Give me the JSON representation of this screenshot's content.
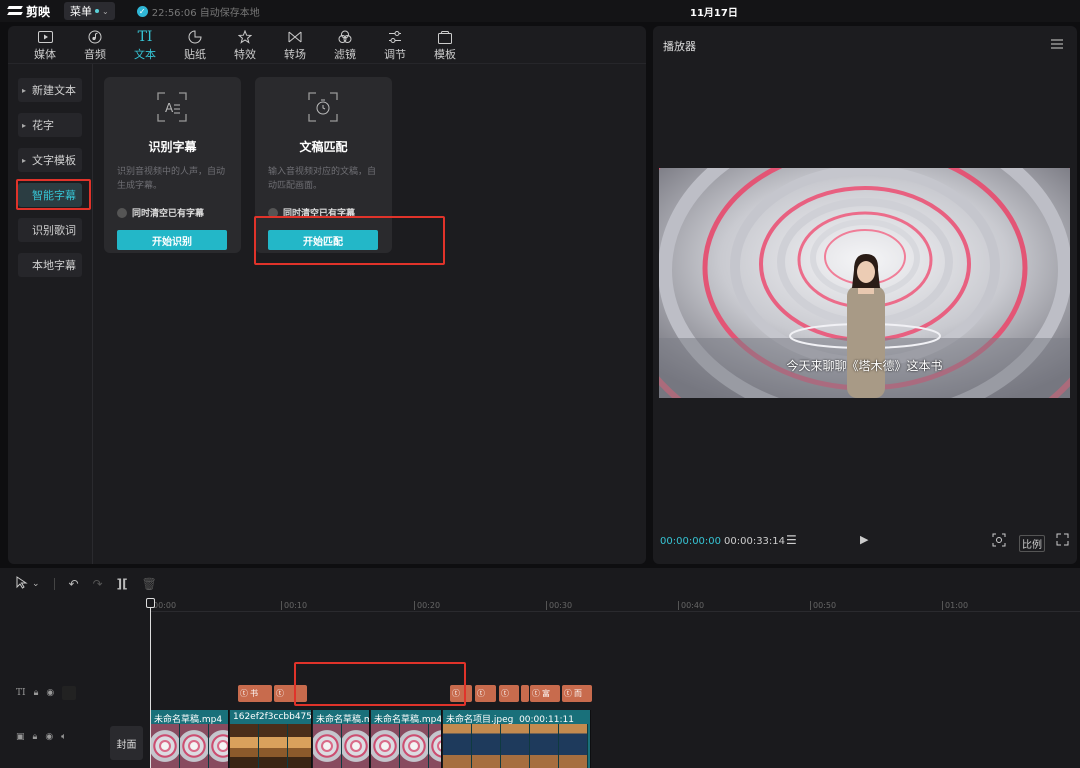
{
  "topbar": {
    "app_name": "剪映",
    "menu_label": "菜单",
    "save_status": "22:56:06 自动保存本地",
    "date": "11月17日"
  },
  "toolbar": {
    "tabs": [
      {
        "label": "媒体",
        "icon": "media-icon"
      },
      {
        "label": "音频",
        "icon": "audio-icon"
      },
      {
        "label": "文本",
        "icon": "text-icon",
        "glyph": "TI"
      },
      {
        "label": "贴纸",
        "icon": "sticker-icon"
      },
      {
        "label": "特效",
        "icon": "effects-icon"
      },
      {
        "label": "转场",
        "icon": "transition-icon"
      },
      {
        "label": "滤镜",
        "icon": "filter-icon"
      },
      {
        "label": "调节",
        "icon": "adjust-icon"
      },
      {
        "label": "模板",
        "icon": "template-icon"
      }
    ],
    "active": "文本"
  },
  "sidebar": {
    "items": [
      {
        "label": "新建文本"
      },
      {
        "label": "花字"
      },
      {
        "label": "文字模板"
      },
      {
        "label": "智能字幕"
      },
      {
        "label": "识别歌词"
      },
      {
        "label": "本地字幕"
      }
    ],
    "active": "智能字幕"
  },
  "cards": [
    {
      "title": "识别字幕",
      "desc": "识别音视频中的人声，自动生成字幕。",
      "checkbox": "同时清空已有字幕",
      "button": "开始识别"
    },
    {
      "title": "文稿匹配",
      "desc": "输入音视频对应的文稿，自动匹配画面。",
      "checkbox": "同时清空已有字幕",
      "button": "开始匹配"
    }
  ],
  "player": {
    "title": "播放器",
    "subtitle": "今天来聊聊《塔木德》这本书",
    "current_time": "00:00:00:00",
    "total_time": "00:00:33:14",
    "ratio_label": "比例"
  },
  "timeline": {
    "ruler": [
      "00:00",
      "00:10",
      "00:20",
      "00:30",
      "00:40",
      "00:50",
      "01:00"
    ],
    "text_clips": [
      "书",
      "",
      "",
      "",
      "",
      "",
      "富",
      "而"
    ],
    "cover_label": "封面",
    "video_clips": [
      {
        "label": "未命名草稿.mp4",
        "thumb": "tunnel"
      },
      {
        "label": "162ef2f3ccbb475c",
        "thumb": "room"
      },
      {
        "label": "未命名草稿.m",
        "thumb": "tunnel"
      },
      {
        "label": "未命名草稿.mp4",
        "thumb": "tunnel"
      },
      {
        "label": "未命名项目.jpeg",
        "thumb": "aquarium",
        "duration": "00:00:11:11"
      }
    ]
  },
  "colors": {
    "accent": "#36c3d3",
    "highlight_box": "#e0332a",
    "text_clip": "#c86b4d",
    "video_clip": "#19707a"
  }
}
